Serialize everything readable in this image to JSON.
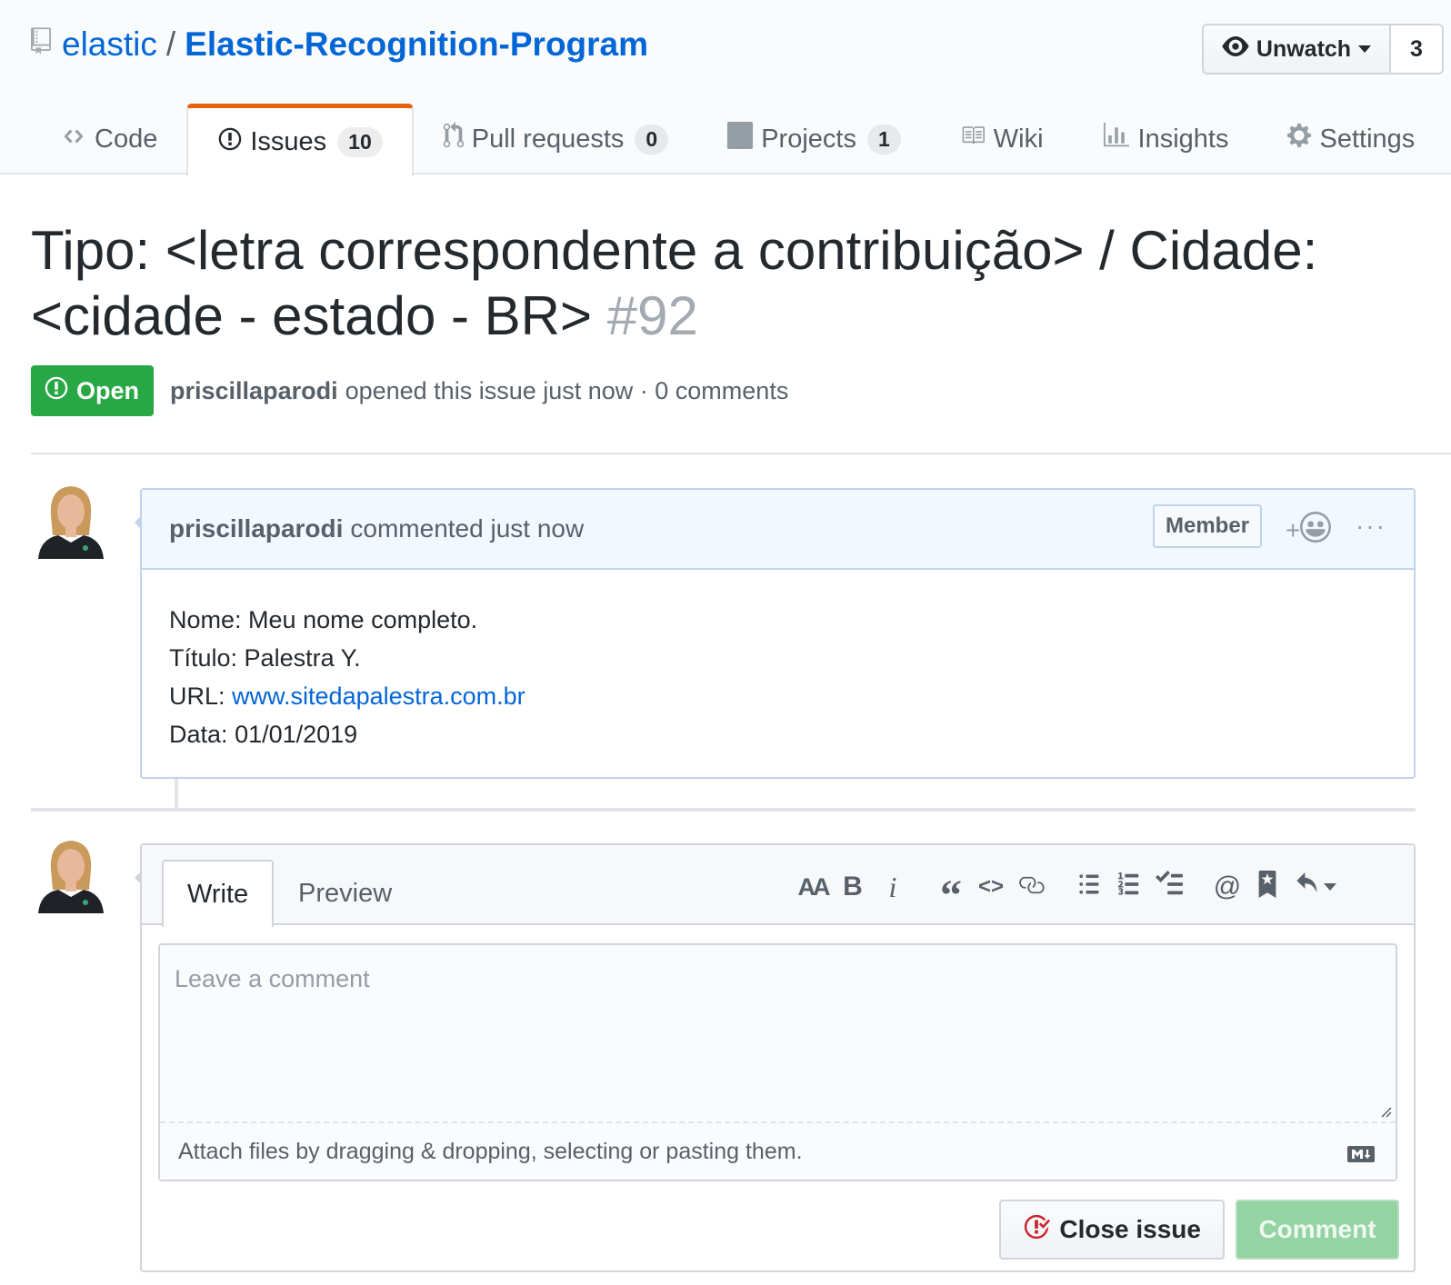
{
  "repo": {
    "owner": "elastic",
    "separator": "/",
    "name": "Elastic-Recognition-Program",
    "watch_label": "Unwatch",
    "watch_count": "3"
  },
  "tabs": [
    {
      "label": "Code",
      "count": null,
      "icon": "code-icon"
    },
    {
      "label": "Issues",
      "count": "10",
      "icon": "issue-opened-icon"
    },
    {
      "label": "Pull requests",
      "count": "0",
      "icon": "git-pull-request-icon"
    },
    {
      "label": "Projects",
      "count": "1",
      "icon": "project-icon"
    },
    {
      "label": "Wiki",
      "count": null,
      "icon": "book-icon"
    },
    {
      "label": "Insights",
      "count": null,
      "icon": "graph-icon"
    },
    {
      "label": "Settings",
      "count": null,
      "icon": "gear-icon"
    }
  ],
  "issue": {
    "title": "Tipo: <letra correspondente a contribuição> / Cidade: <cidade - estado - BR>",
    "number": "#92",
    "state": "Open",
    "author": "priscillaparodi",
    "meta_text": "opened this issue just now · 0 comments"
  },
  "comment": {
    "author": "priscillaparodi",
    "action": "commented just now",
    "badge": "Member",
    "reaction_plus": "+",
    "more": "···",
    "lines": [
      {
        "label": "Nome:",
        "value": "Meu nome completo."
      },
      {
        "label": "Título:",
        "value": "Palestra Y."
      },
      {
        "label": "URL:",
        "link": "www.sitedapalestra.com.br"
      },
      {
        "label": "Data:",
        "value": "01/01/2019"
      }
    ]
  },
  "form": {
    "write_tab": "Write",
    "preview_tab": "Preview",
    "placeholder": "Leave a comment",
    "attach_hint": "Attach files by dragging & dropping, selecting or pasting them.",
    "close_label": "Close issue",
    "comment_label": "Comment",
    "toolbar": {
      "header": "AA",
      "bold": "B",
      "italic": "i",
      "quote": "“",
      "code": "<>",
      "mention": "@"
    }
  },
  "colors": {
    "link": "#0366d6",
    "open_green": "#28a745",
    "active_tab_accent": "#e36209",
    "comment_header_bg": "#f1f8ff"
  }
}
